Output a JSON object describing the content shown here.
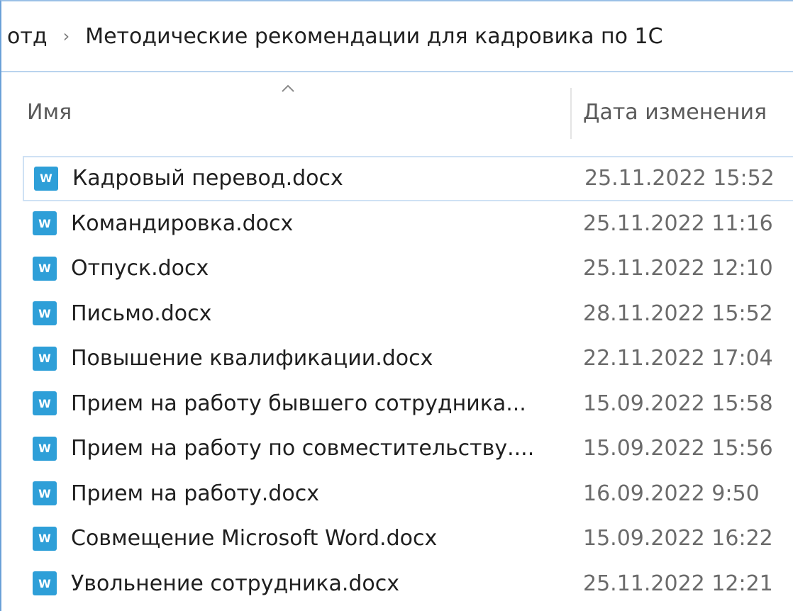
{
  "breadcrumb": {
    "parent": "отд",
    "separator": "›",
    "current": "Методические рекомендации для кадровика по 1С"
  },
  "columns": {
    "name": "Имя",
    "date_modified": "Дата изменения",
    "sort_indicator": "sort-ascending-icon"
  },
  "files": [
    {
      "name": "Кадровый перевод.docx",
      "date": "25.11.2022 15:52",
      "icon": "word-document-icon",
      "selected": true
    },
    {
      "name": "Командировка.docx",
      "date": "25.11.2022 11:16",
      "icon": "word-document-icon"
    },
    {
      "name": "Отпуск.docx",
      "date": "25.11.2022 12:10",
      "icon": "word-document-icon"
    },
    {
      "name": "Письмо.docx",
      "date": "28.11.2022 15:52",
      "icon": "word-document-icon"
    },
    {
      "name": "Повышение квалификации.docx",
      "date": "22.11.2022 17:04",
      "icon": "word-document-icon"
    },
    {
      "name": "Прием на работу бывшего сотрудника...",
      "date": "15.09.2022 15:58",
      "icon": "word-document-icon"
    },
    {
      "name": "Прием на работу по совместительству....",
      "date": "15.09.2022 15:56",
      "icon": "word-document-icon"
    },
    {
      "name": "Прием на работу.docx",
      "date": "16.09.2022 9:50",
      "icon": "word-document-icon"
    },
    {
      "name": "Совмещение Microsoft Word.docx",
      "date": "15.09.2022 16:22",
      "icon": "word-document-icon"
    },
    {
      "name": "Увольнение сотрудника.docx",
      "date": "25.11.2022 12:21",
      "icon": "word-document-icon"
    }
  ],
  "icon_letter": "W",
  "colors": {
    "accent": "#2e9fd8",
    "selection_border": "#cfe1f4"
  }
}
